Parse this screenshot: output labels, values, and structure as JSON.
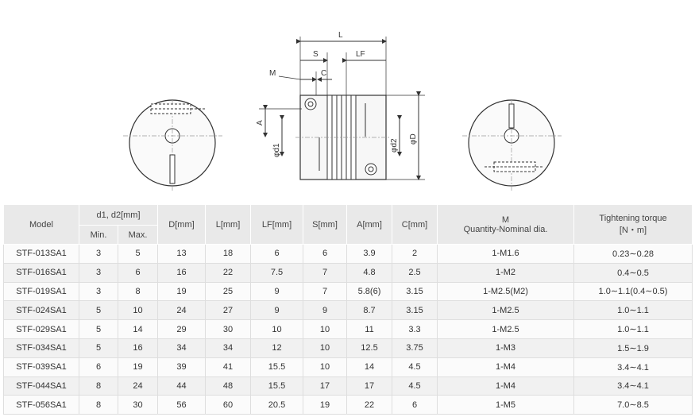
{
  "drawing": {
    "dims": {
      "L": "L",
      "S": "S",
      "LF": "LF",
      "M": "M",
      "C": "C",
      "A": "A",
      "d1": "φd1",
      "d2": "φd2",
      "D": "φD"
    }
  },
  "table": {
    "header": {
      "model": "Model",
      "d_group": "d1, d2[mm]",
      "min": "Min.",
      "max": "Max.",
      "D": "D[mm]",
      "L": "L[mm]",
      "LF": "LF[mm]",
      "S": "S[mm]",
      "A": "A[mm]",
      "C": "C[mm]",
      "M_line1": "M",
      "M_line2": "Quantity-Nominal dia.",
      "torque_line1": "Tightening torque",
      "torque_line2": "[N・m]"
    },
    "rows": [
      [
        "STF-013SA1",
        "3",
        "5",
        "13",
        "18",
        "6",
        "6",
        "3.9",
        "2",
        "1-M1.6",
        "0.23∼0.28"
      ],
      [
        "STF-016SA1",
        "3",
        "6",
        "16",
        "22",
        "7.5",
        "7",
        "4.8",
        "2.5",
        "1-M2",
        "0.4∼0.5"
      ],
      [
        "STF-019SA1",
        "3",
        "8",
        "19",
        "25",
        "9",
        "7",
        "5.8(6)",
        "3.15",
        "1-M2.5(M2)",
        "1.0∼1.1(0.4∼0.5)"
      ],
      [
        "STF-024SA1",
        "5",
        "10",
        "24",
        "27",
        "9",
        "9",
        "8.7",
        "3.15",
        "1-M2.5",
        "1.0∼1.1"
      ],
      [
        "STF-029SA1",
        "5",
        "14",
        "29",
        "30",
        "10",
        "10",
        "11",
        "3.3",
        "1-M2.5",
        "1.0∼1.1"
      ],
      [
        "STF-034SA1",
        "5",
        "16",
        "34",
        "34",
        "12",
        "10",
        "12.5",
        "3.75",
        "1-M3",
        "1.5∼1.9"
      ],
      [
        "STF-039SA1",
        "6",
        "19",
        "39",
        "41",
        "15.5",
        "10",
        "14",
        "4.5",
        "1-M4",
        "3.4∼4.1"
      ],
      [
        "STF-044SA1",
        "8",
        "24",
        "44",
        "48",
        "15.5",
        "17",
        "17",
        "4.5",
        "1-M4",
        "3.4∼4.1"
      ],
      [
        "STF-056SA1",
        "8",
        "30",
        "56",
        "60",
        "20.5",
        "19",
        "22",
        "6",
        "1-M5",
        "7.0∼8.5"
      ]
    ]
  }
}
